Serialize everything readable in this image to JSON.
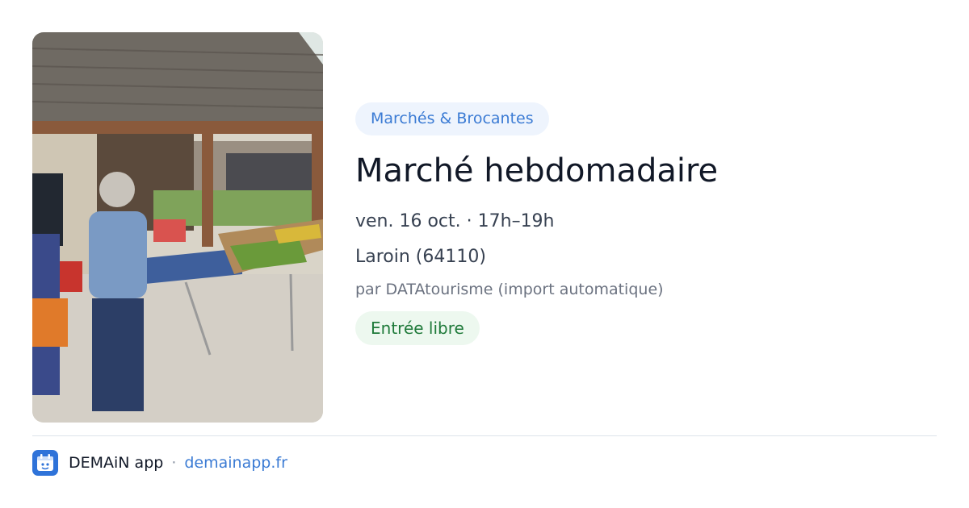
{
  "event": {
    "category": "Marchés & Brocantes",
    "title": "Marché hebdomadaire",
    "date_time": "ven. 16 oct. · 17h–19h",
    "location": "Laroin (64110)",
    "organizer": "par DATAtourisme (import automatique)",
    "price": "Entrée libre"
  },
  "footer": {
    "app_name": "DEMAiN app",
    "separator": "·",
    "site": "demainapp.fr",
    "app_icon": "demain-app-icon"
  },
  "colors": {
    "category_bg": "#eef4fd",
    "category_text": "#3b7bd4",
    "price_bg": "#edf8ef",
    "price_text": "#1f7a3a",
    "link": "#3b7bd4",
    "app_icon_bg": "#2f73d9"
  }
}
